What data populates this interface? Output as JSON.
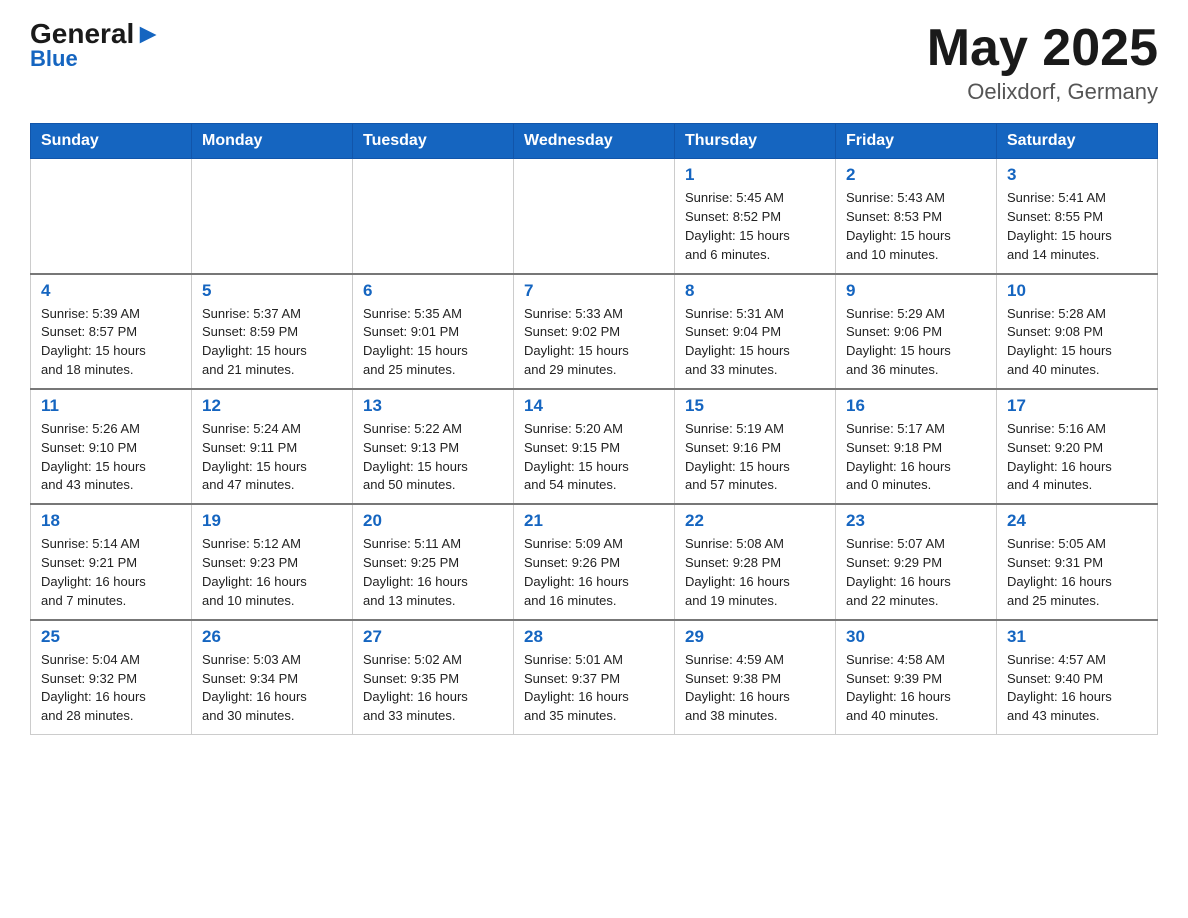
{
  "header": {
    "logo_general": "General",
    "logo_blue": "Blue",
    "month_year": "May 2025",
    "location": "Oelixdorf, Germany"
  },
  "days_of_week": [
    "Sunday",
    "Monday",
    "Tuesday",
    "Wednesday",
    "Thursday",
    "Friday",
    "Saturday"
  ],
  "weeks": [
    [
      {
        "day": "",
        "info": ""
      },
      {
        "day": "",
        "info": ""
      },
      {
        "day": "",
        "info": ""
      },
      {
        "day": "",
        "info": ""
      },
      {
        "day": "1",
        "info": "Sunrise: 5:45 AM\nSunset: 8:52 PM\nDaylight: 15 hours\nand 6 minutes."
      },
      {
        "day": "2",
        "info": "Sunrise: 5:43 AM\nSunset: 8:53 PM\nDaylight: 15 hours\nand 10 minutes."
      },
      {
        "day": "3",
        "info": "Sunrise: 5:41 AM\nSunset: 8:55 PM\nDaylight: 15 hours\nand 14 minutes."
      }
    ],
    [
      {
        "day": "4",
        "info": "Sunrise: 5:39 AM\nSunset: 8:57 PM\nDaylight: 15 hours\nand 18 minutes."
      },
      {
        "day": "5",
        "info": "Sunrise: 5:37 AM\nSunset: 8:59 PM\nDaylight: 15 hours\nand 21 minutes."
      },
      {
        "day": "6",
        "info": "Sunrise: 5:35 AM\nSunset: 9:01 PM\nDaylight: 15 hours\nand 25 minutes."
      },
      {
        "day": "7",
        "info": "Sunrise: 5:33 AM\nSunset: 9:02 PM\nDaylight: 15 hours\nand 29 minutes."
      },
      {
        "day": "8",
        "info": "Sunrise: 5:31 AM\nSunset: 9:04 PM\nDaylight: 15 hours\nand 33 minutes."
      },
      {
        "day": "9",
        "info": "Sunrise: 5:29 AM\nSunset: 9:06 PM\nDaylight: 15 hours\nand 36 minutes."
      },
      {
        "day": "10",
        "info": "Sunrise: 5:28 AM\nSunset: 9:08 PM\nDaylight: 15 hours\nand 40 minutes."
      }
    ],
    [
      {
        "day": "11",
        "info": "Sunrise: 5:26 AM\nSunset: 9:10 PM\nDaylight: 15 hours\nand 43 minutes."
      },
      {
        "day": "12",
        "info": "Sunrise: 5:24 AM\nSunset: 9:11 PM\nDaylight: 15 hours\nand 47 minutes."
      },
      {
        "day": "13",
        "info": "Sunrise: 5:22 AM\nSunset: 9:13 PM\nDaylight: 15 hours\nand 50 minutes."
      },
      {
        "day": "14",
        "info": "Sunrise: 5:20 AM\nSunset: 9:15 PM\nDaylight: 15 hours\nand 54 minutes."
      },
      {
        "day": "15",
        "info": "Sunrise: 5:19 AM\nSunset: 9:16 PM\nDaylight: 15 hours\nand 57 minutes."
      },
      {
        "day": "16",
        "info": "Sunrise: 5:17 AM\nSunset: 9:18 PM\nDaylight: 16 hours\nand 0 minutes."
      },
      {
        "day": "17",
        "info": "Sunrise: 5:16 AM\nSunset: 9:20 PM\nDaylight: 16 hours\nand 4 minutes."
      }
    ],
    [
      {
        "day": "18",
        "info": "Sunrise: 5:14 AM\nSunset: 9:21 PM\nDaylight: 16 hours\nand 7 minutes."
      },
      {
        "day": "19",
        "info": "Sunrise: 5:12 AM\nSunset: 9:23 PM\nDaylight: 16 hours\nand 10 minutes."
      },
      {
        "day": "20",
        "info": "Sunrise: 5:11 AM\nSunset: 9:25 PM\nDaylight: 16 hours\nand 13 minutes."
      },
      {
        "day": "21",
        "info": "Sunrise: 5:09 AM\nSunset: 9:26 PM\nDaylight: 16 hours\nand 16 minutes."
      },
      {
        "day": "22",
        "info": "Sunrise: 5:08 AM\nSunset: 9:28 PM\nDaylight: 16 hours\nand 19 minutes."
      },
      {
        "day": "23",
        "info": "Sunrise: 5:07 AM\nSunset: 9:29 PM\nDaylight: 16 hours\nand 22 minutes."
      },
      {
        "day": "24",
        "info": "Sunrise: 5:05 AM\nSunset: 9:31 PM\nDaylight: 16 hours\nand 25 minutes."
      }
    ],
    [
      {
        "day": "25",
        "info": "Sunrise: 5:04 AM\nSunset: 9:32 PM\nDaylight: 16 hours\nand 28 minutes."
      },
      {
        "day": "26",
        "info": "Sunrise: 5:03 AM\nSunset: 9:34 PM\nDaylight: 16 hours\nand 30 minutes."
      },
      {
        "day": "27",
        "info": "Sunrise: 5:02 AM\nSunset: 9:35 PM\nDaylight: 16 hours\nand 33 minutes."
      },
      {
        "day": "28",
        "info": "Sunrise: 5:01 AM\nSunset: 9:37 PM\nDaylight: 16 hours\nand 35 minutes."
      },
      {
        "day": "29",
        "info": "Sunrise: 4:59 AM\nSunset: 9:38 PM\nDaylight: 16 hours\nand 38 minutes."
      },
      {
        "day": "30",
        "info": "Sunrise: 4:58 AM\nSunset: 9:39 PM\nDaylight: 16 hours\nand 40 minutes."
      },
      {
        "day": "31",
        "info": "Sunrise: 4:57 AM\nSunset: 9:40 PM\nDaylight: 16 hours\nand 43 minutes."
      }
    ]
  ]
}
